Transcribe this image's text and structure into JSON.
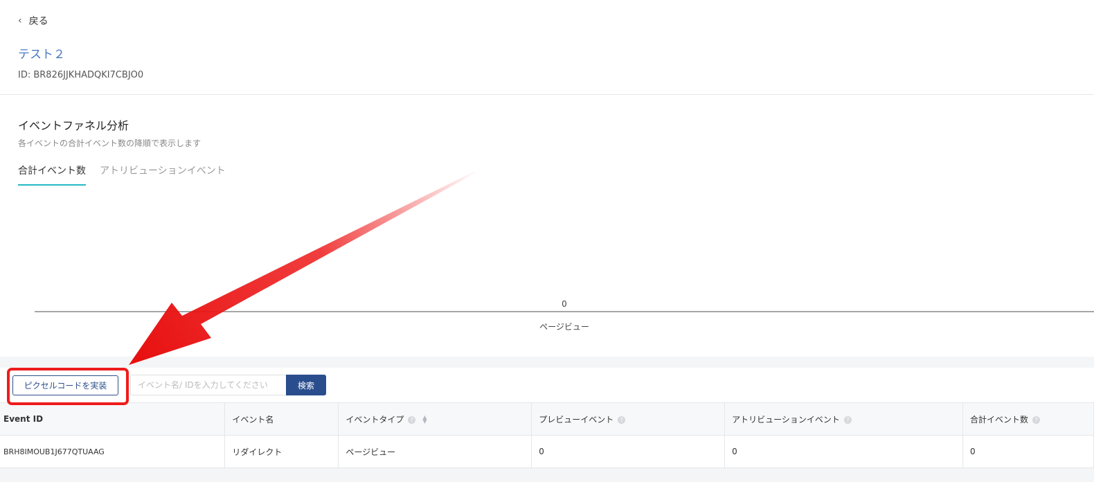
{
  "header": {
    "back_label": "戻る",
    "title": "テスト２",
    "id_text": "ID: BR826JJKHADQKI7CBJO0"
  },
  "funnel": {
    "title": "イベントファネル分析",
    "subtitle": "各イベントの合計イベント数の降順で表示します",
    "tabs": [
      {
        "label": "合計イベント数",
        "active": true
      },
      {
        "label": "アトリビューションイベント",
        "active": false
      }
    ]
  },
  "chart_data": {
    "type": "bar",
    "categories": [
      "ページビュー"
    ],
    "values": [
      0
    ],
    "data_labels": [
      "0"
    ],
    "title": "",
    "xlabel": "",
    "ylabel": ""
  },
  "toolbar": {
    "pixel_button_label": "ピクセルコードを実装",
    "search_placeholder": "イベント名/ IDを入力してください",
    "search_button_label": "検索"
  },
  "table": {
    "columns": [
      {
        "label": "Event ID",
        "help": false,
        "sortable": false
      },
      {
        "label": "イベント名",
        "help": false,
        "sortable": false
      },
      {
        "label": "イベントタイプ",
        "help": true,
        "sortable": true
      },
      {
        "label": "プレビューイベント",
        "help": true,
        "sortable": false
      },
      {
        "label": "アトリビューションイベント",
        "help": true,
        "sortable": false
      },
      {
        "label": "合計イベント数",
        "help": true,
        "sortable": false
      }
    ],
    "rows": [
      [
        "BRH8IMOUB1J677QTUAAG",
        "リダイレクト",
        "ページビュー",
        "0",
        "0",
        "0"
      ]
    ]
  },
  "annotation": {
    "arrow_color": "#ee1c1c",
    "highlight_color": "#ee1c1c"
  }
}
